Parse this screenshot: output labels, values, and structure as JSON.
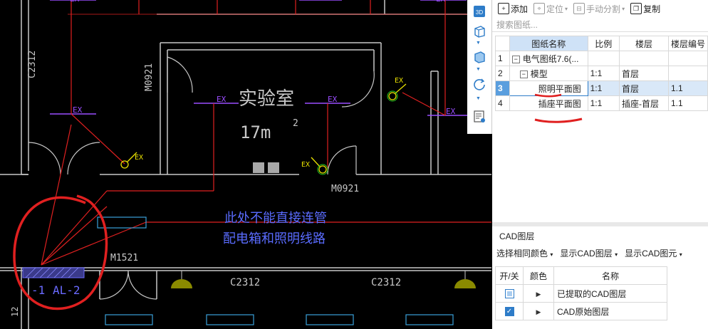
{
  "cad": {
    "room_name": "实验室",
    "room_area": "17m",
    "area_exp": "2",
    "door_label_1": "M0921",
    "door_label_2": "M0921",
    "door_label_3": "M1521",
    "window_label_1": "C2312",
    "window_label_2": "C2312",
    "window_label_3": "C2312",
    "fixture_tag": "EX",
    "annotation_line1": "此处不能直接连管",
    "annotation_line2": "配电箱和照明线路",
    "panel_label_1": "-1",
    "panel_label_2": "AL-2",
    "edge_label": "12"
  },
  "toolstrip": {
    "btn_3d": "3D"
  },
  "toolbar": {
    "add": "添加",
    "locate": "定位",
    "manual_split": "手动分割",
    "copy": "复制"
  },
  "search": {
    "placeholder": "搜索图纸..."
  },
  "sheets": {
    "headers": [
      "",
      "图纸名称",
      "比例",
      "楼层",
      "楼层编号"
    ],
    "rows": [
      {
        "num": "1",
        "toggle": "−",
        "name": "电气图纸7.6(...",
        "scale": "",
        "floor": "",
        "floor_no": ""
      },
      {
        "num": "2",
        "toggle": "−",
        "name": "模型",
        "scale": "1:1",
        "floor": "首层",
        "floor_no": ""
      },
      {
        "num": "3",
        "toggle": "",
        "name": "照明平面图",
        "scale": "1:1",
        "floor": "首层",
        "floor_no": "1.1"
      },
      {
        "num": "4",
        "toggle": "",
        "name": "插座平面图",
        "scale": "1:1",
        "floor": "插座-首层",
        "floor_no": "1.1"
      }
    ]
  },
  "cad_layers": {
    "title": "CAD图层",
    "tools": [
      "选择相同颜色",
      "显示CAD图层",
      "显示CAD图元"
    ],
    "headers": [
      "开/关",
      "颜色",
      "名称"
    ],
    "rows": [
      {
        "state": "partial",
        "name": "已提取的CAD图层"
      },
      {
        "state": "on",
        "name": "CAD原始图层"
      }
    ]
  },
  "colors": {
    "wall": "#c8c8c8",
    "wire": "#e02020",
    "fixture": "#9b4dff",
    "light": "#e8e000",
    "highlight_circle": "#e02020",
    "accent": "#2e7cc8"
  }
}
